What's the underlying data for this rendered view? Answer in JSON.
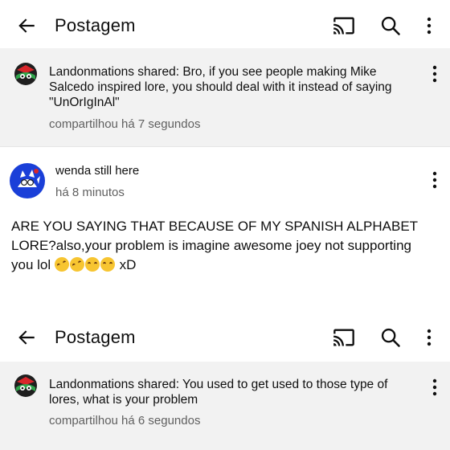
{
  "header_top": {
    "title": "Postagem"
  },
  "shared_top": {
    "author": "Landonmations shared:",
    "text": " Bro, if you see people making Mike Salcedo inspired lore, you should deal with it instead of saying \"UnOrIgInAl\"",
    "time": "compartilhou há 7 segundos"
  },
  "comment": {
    "author": "wenda still here",
    "time": "há 8 minutos",
    "text": "ARE YOU SAYING THAT BECAUSE OF MY SPANISH ALPHABET LORE?also,your problem is imagine awesome joey not supporting you lol ",
    "suffix": " xD"
  },
  "header_bottom": {
    "title": "Postagem"
  },
  "shared_bottom": {
    "author": "Landonmations shared:",
    "text": " You used to get used to those type of lores, what is your problem",
    "time": "compartilhou há 6 segundos"
  },
  "icons": [
    "back-arrow-icon",
    "cast-icon",
    "search-icon",
    "more-vert-icon"
  ],
  "colors": {
    "shared_bg": "#f2f2f2",
    "secondary_text": "#606060",
    "comment_avatar_bg": "#1a3fd8"
  }
}
